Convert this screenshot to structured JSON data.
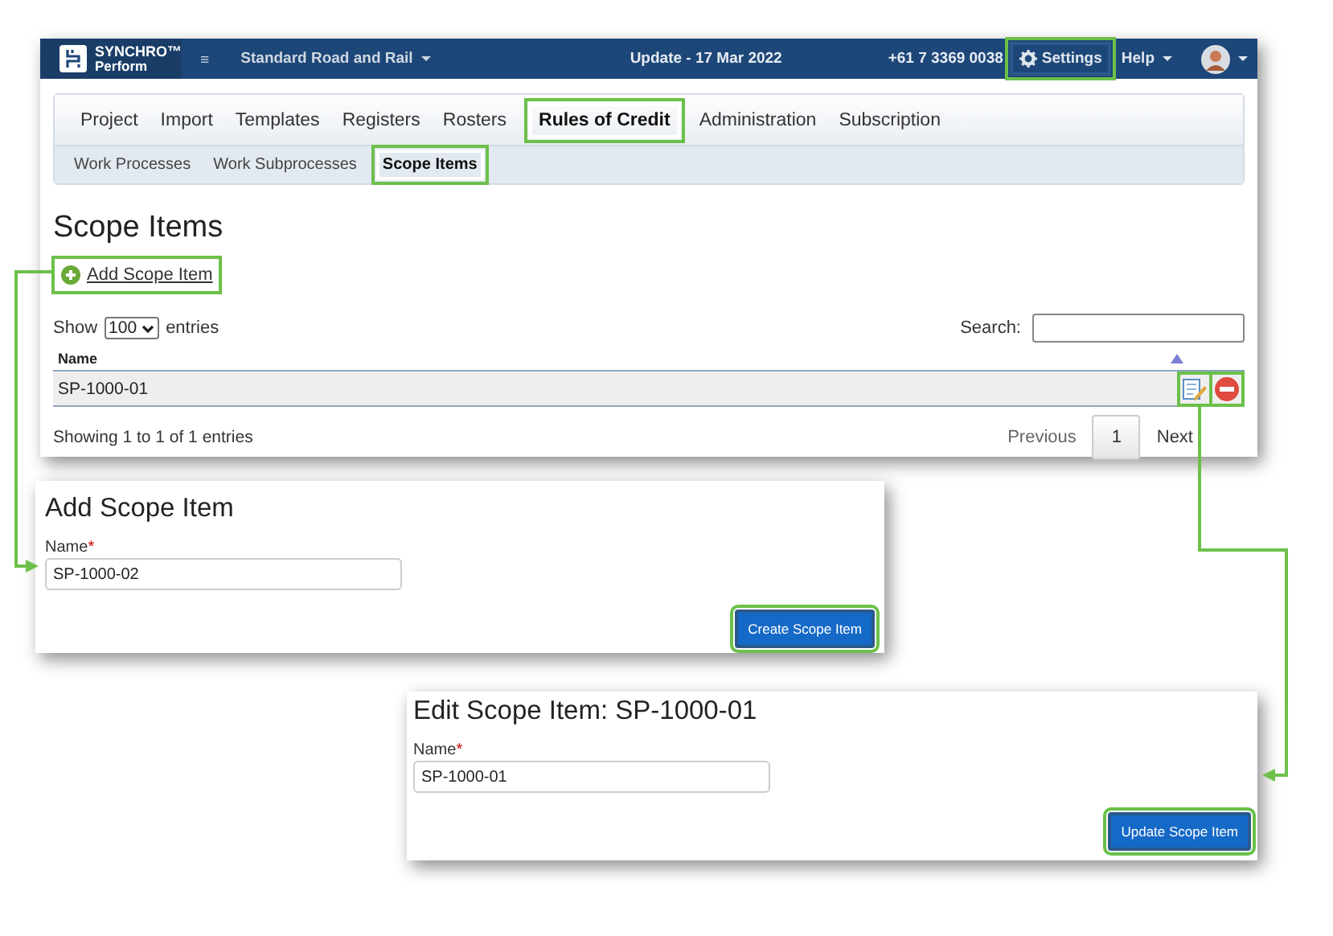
{
  "navbar": {
    "brand": "SYNCHRO™",
    "brand_sub": "Perform",
    "project": "Standard Road and Rail",
    "update": "Update - 17 Mar 2022",
    "phone": "+61 7 3369 0038",
    "settings": {
      "label": "Settings",
      "highlighted": true
    },
    "help": "Help"
  },
  "menu": [
    {
      "label": "Project",
      "selected": false,
      "highlighted": false
    },
    {
      "label": "Import",
      "selected": false,
      "highlighted": false
    },
    {
      "label": "Templates",
      "selected": false,
      "highlighted": false
    },
    {
      "label": "Registers",
      "selected": false,
      "highlighted": false
    },
    {
      "label": "Rosters",
      "selected": false,
      "highlighted": false
    },
    {
      "label": "Rules of Credit",
      "selected": true,
      "highlighted": true
    },
    {
      "label": "Administration",
      "selected": false,
      "highlighted": false
    },
    {
      "label": "Subscription",
      "selected": false,
      "highlighted": false
    }
  ],
  "submenu": [
    {
      "label": "Work Processes",
      "selected": false,
      "highlighted": false
    },
    {
      "label": "Work Subprocesses",
      "selected": false,
      "highlighted": false
    },
    {
      "label": "Scope Items",
      "selected": true,
      "highlighted": true
    }
  ],
  "page": {
    "title": "Scope Items",
    "add_link": {
      "label": "Add Scope Item",
      "highlighted": true
    },
    "show": "Show",
    "page_length": "100",
    "entries": "entries",
    "search_label": "Search:",
    "column": "Name",
    "rows": [
      {
        "name": "SP-1000-01",
        "actions": [
          {
            "kind": "edit",
            "highlighted": true
          },
          {
            "kind": "delete",
            "highlighted": true
          }
        ]
      }
    ],
    "info": "Showing 1 to 1 of 1 entries",
    "previous": "Previous",
    "current_page": "1",
    "next": "Next"
  },
  "add_form": {
    "title": "Add Scope Item",
    "field_label": "Name",
    "required_mark": "*",
    "value": "SP-1000-02",
    "button": {
      "label": "Create Scope Item",
      "highlighted": true
    }
  },
  "edit_form": {
    "title": "Edit Scope Item: SP-1000-01",
    "field_label": "Name",
    "required_mark": "*",
    "value": "SP-1000-01",
    "button": {
      "label": "Update Scope Item",
      "highlighted": true
    }
  }
}
